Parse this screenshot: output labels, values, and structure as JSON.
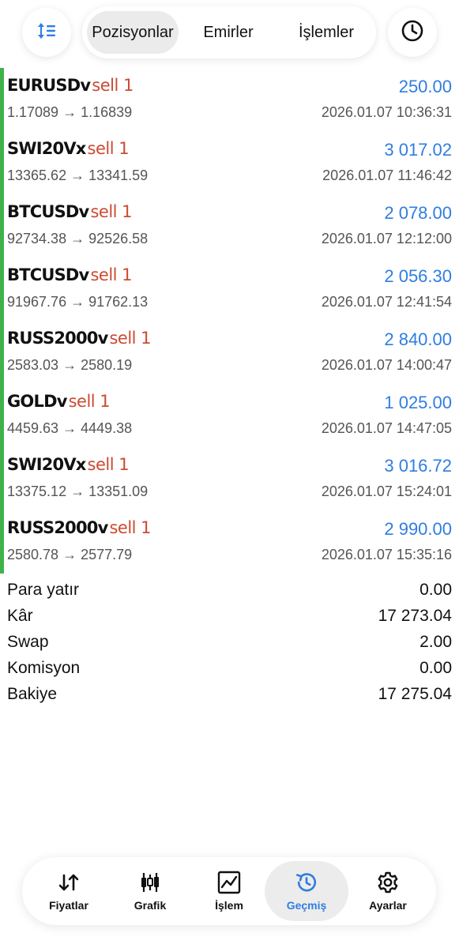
{
  "header": {
    "sort_icon": "sort-icon",
    "clock_icon": "clock-icon",
    "tabs": [
      {
        "label": "Pozisyonlar",
        "active": true
      },
      {
        "label": "Emirler",
        "active": false
      },
      {
        "label": "İşlemler",
        "active": false
      }
    ]
  },
  "colors": {
    "profit": "#2f7de1",
    "sell": "#cc4a32",
    "position_bar": "#3fb34a",
    "accent": "#2f7de1"
  },
  "positions": [
    {
      "symbol": "EURUSDv",
      "direction": "sell 1",
      "profit": "250.00",
      "open_price": "1.17089",
      "arrow": "→",
      "close_price": "1.16839",
      "time": "2026.01.07 10:36:31"
    },
    {
      "symbol": "SWI20Vx",
      "direction": "sell 1",
      "profit": "3 017.02",
      "open_price": "13365.62",
      "arrow": "→",
      "close_price": "13341.59",
      "time": "2026.01.07 11:46:42"
    },
    {
      "symbol": "BTCUSDv",
      "direction": "sell 1",
      "profit": "2 078.00",
      "open_price": "92734.38",
      "arrow": "→",
      "close_price": "92526.58",
      "time": "2026.01.07 12:12:00"
    },
    {
      "symbol": "BTCUSDv",
      "direction": "sell 1",
      "profit": "2 056.30",
      "open_price": "91967.76",
      "arrow": "→",
      "close_price": "91762.13",
      "time": "2026.01.07 12:41:54"
    },
    {
      "symbol": "RUSS2000v",
      "direction": "sell 1",
      "profit": "2 840.00",
      "open_price": "2583.03",
      "arrow": "→",
      "close_price": "2580.19",
      "time": "2026.01.07 14:00:47"
    },
    {
      "symbol": "GOLDv",
      "direction": "sell 1",
      "profit": "1 025.00",
      "open_price": "4459.63",
      "arrow": "→",
      "close_price": "4449.38",
      "time": "2026.01.07 14:47:05"
    },
    {
      "symbol": "SWI20Vx",
      "direction": "sell 1",
      "profit": "3 016.72",
      "open_price": "13375.12",
      "arrow": "→",
      "close_price": "13351.09",
      "time": "2026.01.07 15:24:01"
    },
    {
      "symbol": "RUSS2000v",
      "direction": "sell 1",
      "profit": "2 990.00",
      "open_price": "2580.78",
      "arrow": "→",
      "close_price": "2577.79",
      "time": "2026.01.07 15:35:16"
    }
  ],
  "summary": [
    {
      "label": "Para yatır",
      "value": "0.00"
    },
    {
      "label": "Kâr",
      "value": "17 273.04"
    },
    {
      "label": "Swap",
      "value": "2.00"
    },
    {
      "label": "Komisyon",
      "value": "0.00"
    },
    {
      "label": "Bakiye",
      "value": "17 275.04"
    }
  ],
  "bottom_nav": [
    {
      "label": "Fiyatlar",
      "icon": "price-arrows-icon",
      "active": false
    },
    {
      "label": "Grafik",
      "icon": "candlestick-icon",
      "active": false
    },
    {
      "label": "İşlem",
      "icon": "trade-chart-icon",
      "active": false
    },
    {
      "label": "Geçmiş",
      "icon": "history-icon",
      "active": true
    },
    {
      "label": "Ayarlar",
      "icon": "gear-icon",
      "active": false
    }
  ]
}
